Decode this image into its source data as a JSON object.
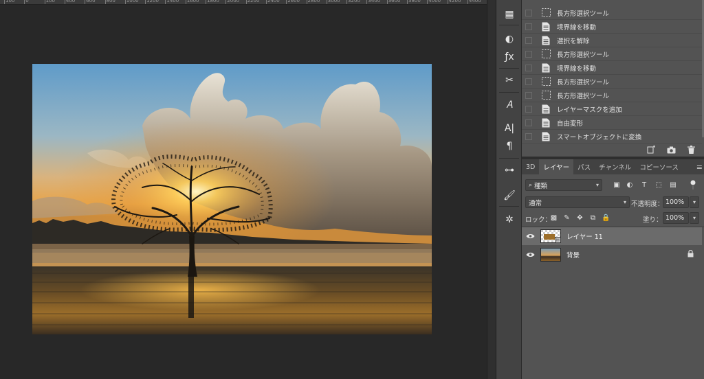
{
  "ruler": {
    "labels": [
      "100",
      "0",
      "100",
      "400",
      "600",
      "800",
      "1000",
      "1200",
      "1400",
      "1600",
      "1800",
      "2000",
      "2200",
      "2400",
      "2600",
      "2800",
      "3000",
      "3200",
      "3400",
      "3600",
      "3800",
      "4000",
      "4200",
      "4400"
    ]
  },
  "tools": [
    {
      "icon": "grid-icon",
      "glyph": "▦"
    },
    {
      "icon": "adjustment-icon",
      "glyph": "◐"
    },
    {
      "icon": "fx-icon",
      "glyph": "ƒx"
    },
    {
      "icon": "tool-presets-icon",
      "glyph": "✂"
    },
    {
      "icon": "glyph-icon",
      "glyph": "𝐴"
    },
    {
      "icon": "character-icon",
      "glyph": "A|"
    },
    {
      "icon": "paragraph-icon",
      "glyph": "¶"
    },
    {
      "icon": "brush-settings-icon",
      "glyph": "⊶"
    },
    {
      "icon": "brush-icon",
      "glyph": "🖌"
    },
    {
      "icon": "3d-axis-icon",
      "glyph": "✲"
    }
  ],
  "history": {
    "items": [
      {
        "label": "長方形選択ツール",
        "icon": "marquee-icon"
      },
      {
        "label": "境界線を移動",
        "icon": "document-icon"
      },
      {
        "label": "選択を解除",
        "icon": "document-icon"
      },
      {
        "label": "長方形選択ツール",
        "icon": "marquee-icon"
      },
      {
        "label": "境界線を移動",
        "icon": "document-icon"
      },
      {
        "label": "長方形選択ツール",
        "icon": "marquee-icon"
      },
      {
        "label": "長方形選択ツール",
        "icon": "marquee-icon"
      },
      {
        "label": "レイヤーマスクを追加",
        "icon": "document-icon"
      },
      {
        "label": "自由変形",
        "icon": "document-icon"
      },
      {
        "label": "スマートオブジェクトに変換",
        "icon": "document-icon"
      }
    ]
  },
  "layers_panel": {
    "tabs": [
      "3D",
      "レイヤー",
      "パス",
      "チャンネル",
      "コピーソース"
    ],
    "active_tab": "レイヤー",
    "filter": "種類",
    "blend_mode": "通常",
    "opacity_label": "不透明度：",
    "opacity": "100%",
    "lock_label": "ロック：",
    "fill_label": "塗り：",
    "fill": "100%",
    "layers": [
      {
        "name": "レイヤー 11",
        "selected": true,
        "locked": false
      },
      {
        "name": "背景",
        "selected": false,
        "locked": true
      }
    ]
  },
  "colors": {
    "panel_bg": "#535353",
    "canvas_bg": "#282828",
    "selected_layer": "#6b6b6b"
  }
}
